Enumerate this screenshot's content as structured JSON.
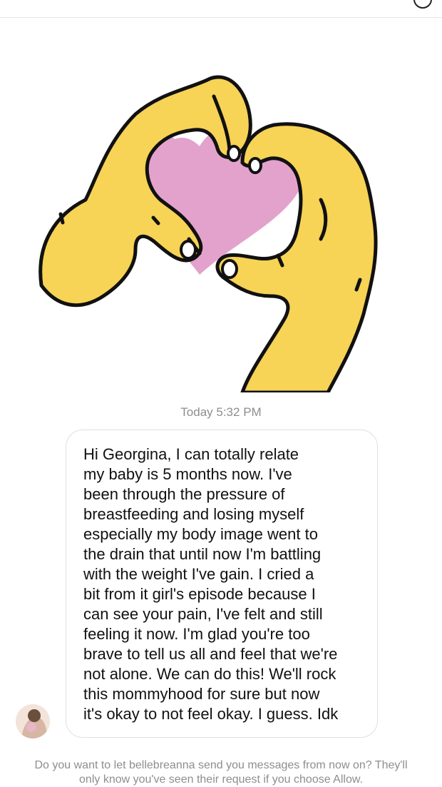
{
  "thread": {
    "timestamp": "Today 5:32 PM",
    "sticker_icon": "heart-hands-icon",
    "colors": {
      "hand_fill": "#F7D356",
      "heart_fill": "#E3A2CC",
      "outline": "#111111",
      "meta_text": "#8e8e8e"
    },
    "message": {
      "sender_avatar": "avatar",
      "lines": [
        "Hi Georgina, I can totally relate",
        "my baby is 5 months now. I've",
        "been through the pressure of",
        "breastfeeding and losing myself",
        "especially my body image went to",
        "the drain that until now I'm battling",
        "with the weight I've gain. I cried a",
        "bit from it girl's episode because I",
        "can see your pain, I've felt and still",
        "feeling it now. I'm glad you're too",
        "brave to tell us all and feel that we're",
        "not alone. We can do this! We'll rock",
        "this mommyhood for sure but now",
        "it's okay to not feel okay. I guess. Idk"
      ]
    }
  },
  "request_notice": {
    "line1": "Do you want to let bellebreanna send you messages from now on? They'll",
    "line2": "only know you've seen their request if you choose Allow."
  }
}
